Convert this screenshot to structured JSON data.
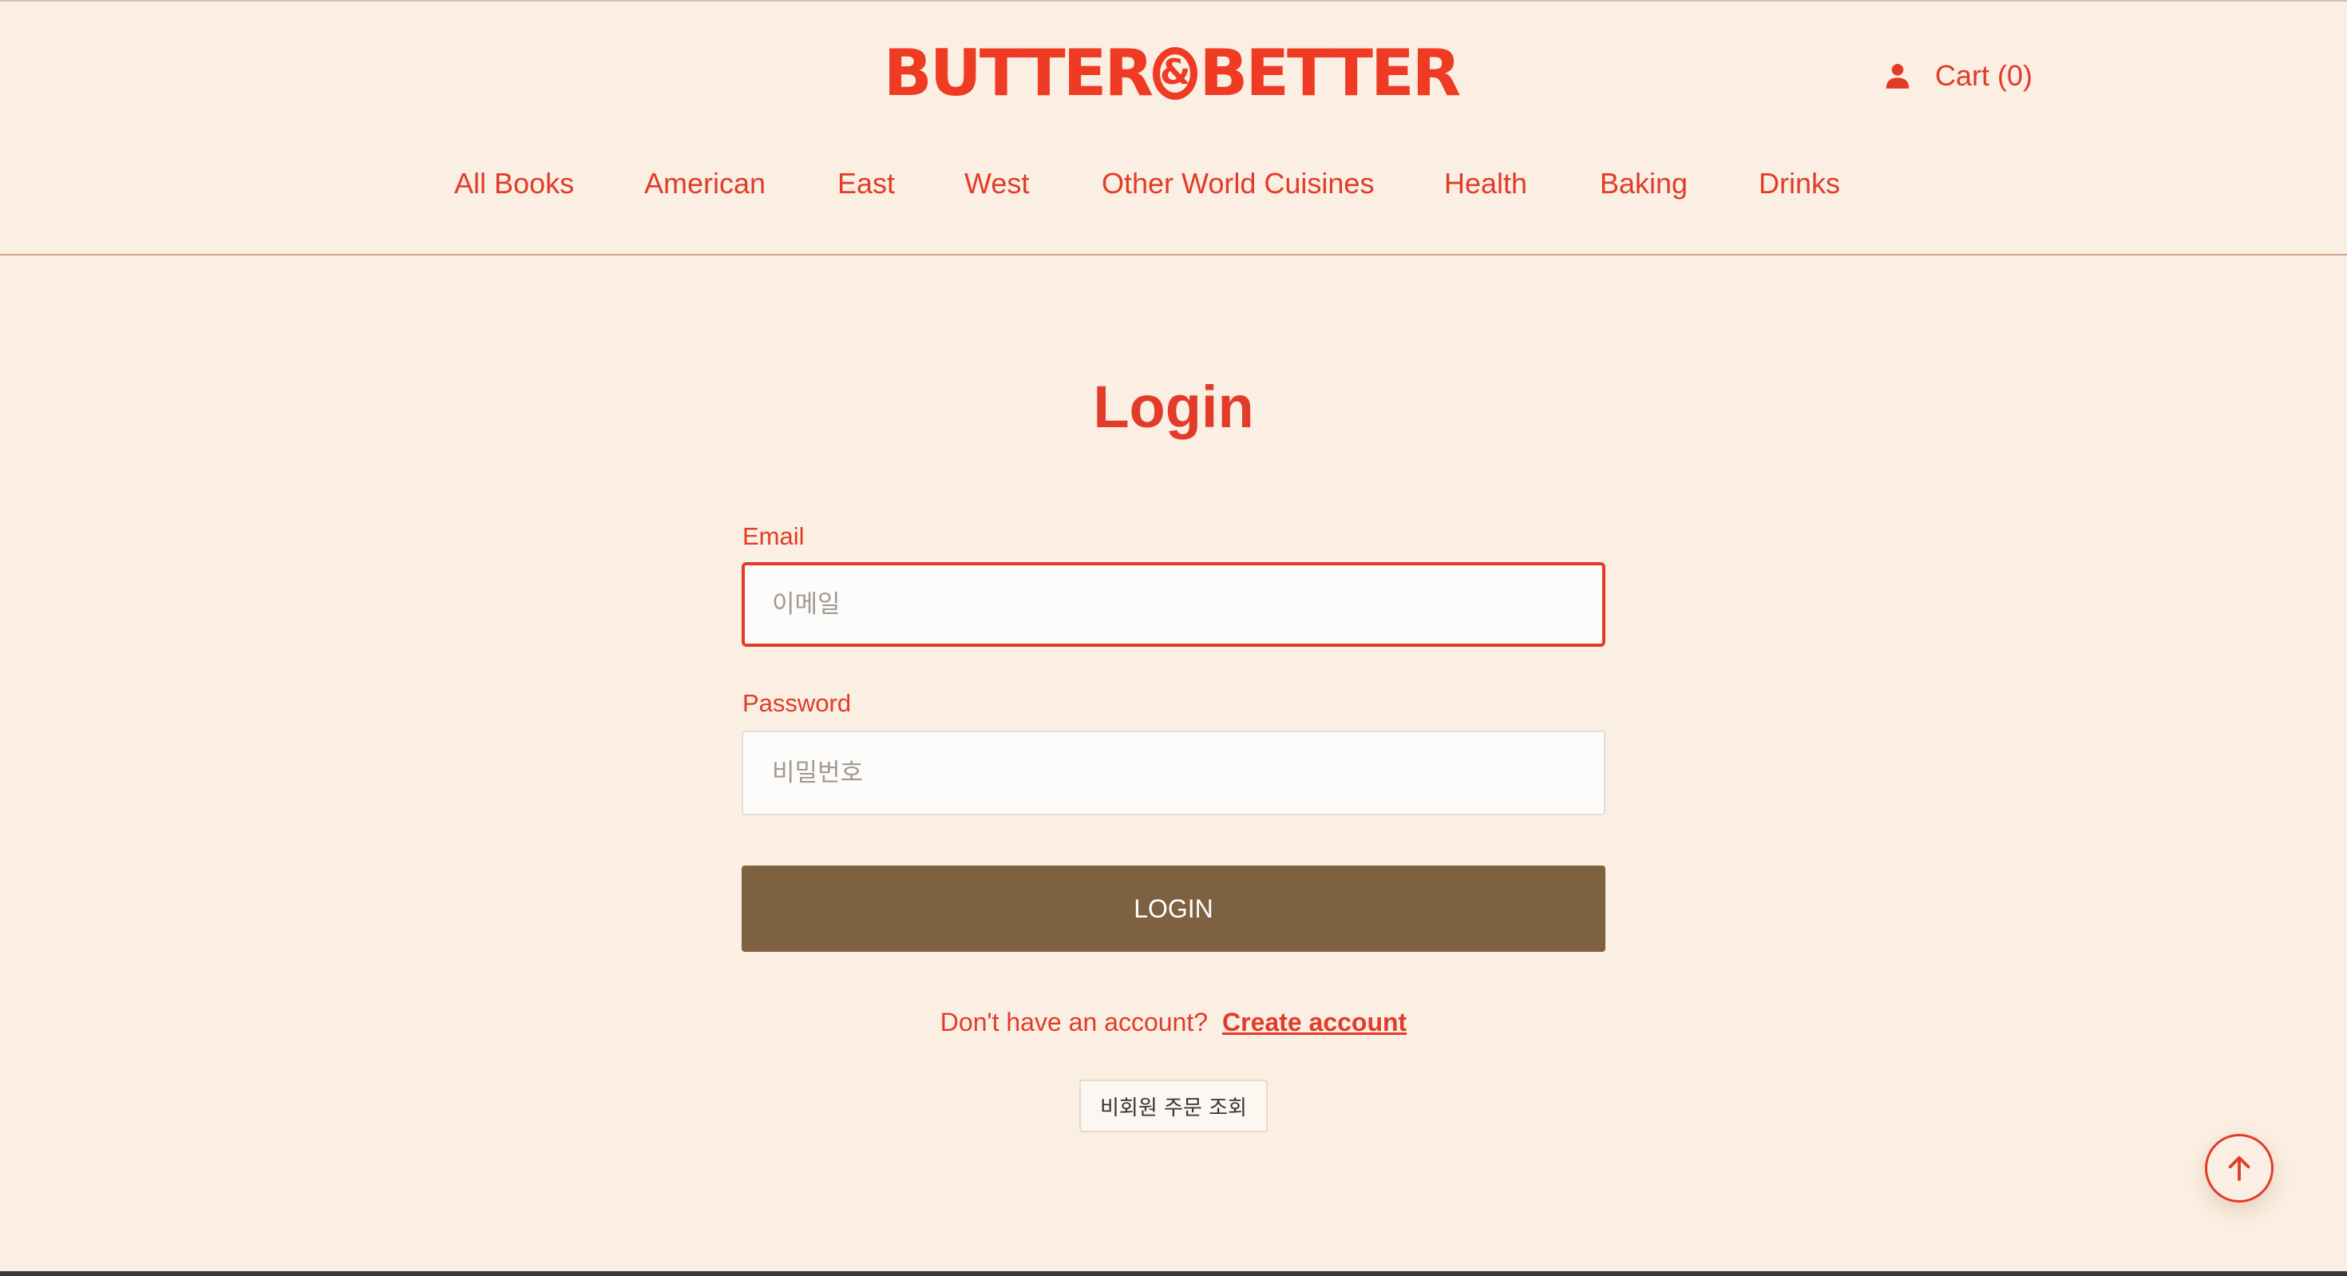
{
  "brand": {
    "logo_left": "BUTTER",
    "logo_amp": "&",
    "logo_right": "BETTER",
    "accent_color": "#e23b2a",
    "button_color": "#7e6140",
    "background_color": "#faefe2"
  },
  "header": {
    "account_icon": "person-icon",
    "cart_label": "Cart (0)"
  },
  "nav": {
    "items": [
      {
        "label": "All Books"
      },
      {
        "label": "American"
      },
      {
        "label": "East"
      },
      {
        "label": "West"
      },
      {
        "label": "Other World Cuisines"
      },
      {
        "label": "Health"
      },
      {
        "label": "Baking"
      },
      {
        "label": "Drinks"
      }
    ]
  },
  "login": {
    "title": "Login",
    "email_label": "Email",
    "email_placeholder": "이메일",
    "email_value": "",
    "password_label": "Password",
    "password_placeholder": "비밀번호",
    "password_value": "",
    "submit_label": "LOGIN",
    "no_account_text": "Don't have an account?",
    "create_account_label": "Create account",
    "guest_order_label": "비회원 주문 조회"
  },
  "scroll_top": {
    "icon": "arrow-up-icon"
  }
}
